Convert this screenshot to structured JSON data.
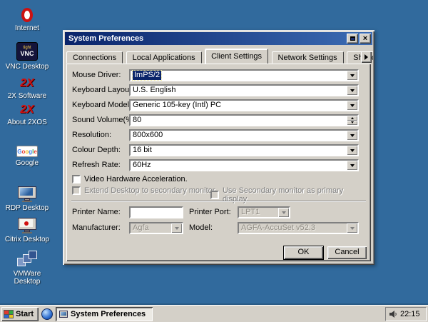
{
  "colors": {
    "desktop_bg": "#316A9D",
    "titlebar_start": "#0A246A",
    "titlebar_end": "#3C6CB4",
    "window_bg": "#D4D0C8",
    "highlight": "#0A246A"
  },
  "desktop": {
    "icons": [
      {
        "label": "Internet",
        "icon": "opera-o-icon"
      },
      {
        "label": "VNC Desktop",
        "icon": "vnc-icon",
        "icon_text": "VNC",
        "icon_subtext": "tight"
      },
      {
        "label": "2X Software",
        "icon": "2x-logo-icon",
        "icon_text": "2X"
      },
      {
        "label": "About 2XOS",
        "icon": "2x-logo-icon",
        "icon_text": "2X"
      },
      {
        "label": "Google",
        "icon": "google-logo-icon",
        "icon_text_letters": [
          "G",
          "o",
          "o",
          "g",
          "l",
          "e"
        ]
      },
      {
        "label": "RDP Desktop",
        "icon": "monitor-icon"
      },
      {
        "label": "Citrix Desktop",
        "icon": "monitor-citrix-icon"
      },
      {
        "label": "VMWare Desktop",
        "icon": "vmware-boxes-icon"
      }
    ]
  },
  "window": {
    "title": "System Preferences",
    "tabs": [
      {
        "label": "Connections",
        "active": false
      },
      {
        "label": "Local Applications",
        "active": false
      },
      {
        "label": "Client Settings",
        "active": true
      },
      {
        "label": "Network Settings",
        "active": false
      },
      {
        "label": "Shadowin",
        "active": false
      }
    ],
    "fields": {
      "mouse_driver": {
        "label": "Mouse Driver:",
        "value": "ImPS/2",
        "selected": true
      },
      "keyboard_layout": {
        "label": "Keyboard Layout:",
        "value": "U.S. English"
      },
      "keyboard_model": {
        "label": "Keyboard Model:",
        "value": "Generic 105-key (Intl) PC"
      },
      "sound_volume": {
        "label": "Sound Volume(%):",
        "value": "80"
      },
      "resolution": {
        "label": "Resolution:",
        "value": "800x600"
      },
      "colour_depth": {
        "label": "Colour Depth:",
        "value": "16 bit"
      },
      "refresh_rate": {
        "label": "Refresh Rate:",
        "value": "60Hz"
      }
    },
    "checkboxes": [
      {
        "label": "Video Hardware Acceleration.",
        "checked": false,
        "disabled": false
      },
      {
        "label": "Extend Desktop to secondary monitor.",
        "checked": false,
        "disabled": true
      },
      {
        "label": "Use Secondary monitor as primary display.",
        "checked": false,
        "disabled": true
      }
    ],
    "printer": {
      "name_label": "Printer Name:",
      "name_value": "",
      "port_label": "Printer Port:",
      "port_value": "LPT1",
      "manufacturer_label": "Manufacturer:",
      "manufacturer_value": "Agfa",
      "model_label": "Model:",
      "model_value": "AGFA-AccuSet v52.3"
    },
    "buttons": {
      "ok": "OK",
      "cancel": "Cancel"
    }
  },
  "taskbar": {
    "start_label": "Start",
    "task_button": "System Preferences",
    "clock": "22:15"
  }
}
